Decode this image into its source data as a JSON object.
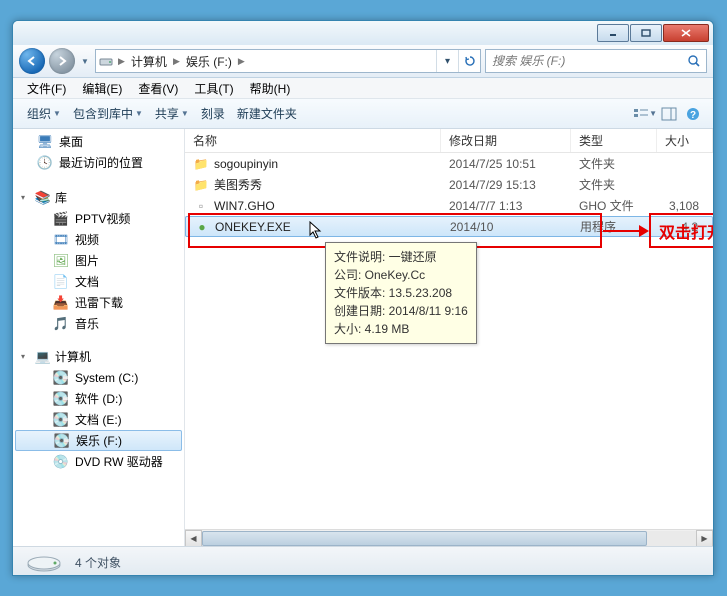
{
  "address": {
    "segments": [
      "计算机",
      "娱乐 (F:)"
    ],
    "search_placeholder": "搜索 娱乐 (F:)"
  },
  "menu": [
    "文件(F)",
    "编辑(E)",
    "查看(V)",
    "工具(T)",
    "帮助(H)"
  ],
  "toolbar": {
    "organize": "组织",
    "include": "包含到库中",
    "share": "共享",
    "burn": "刻录",
    "newfolder": "新建文件夹"
  },
  "sidebar": {
    "desktop": "桌面",
    "recent": "最近访问的位置",
    "libraries": "库",
    "lib_items": [
      "PPTV视频",
      "视频",
      "图片",
      "文档",
      "迅雷下载",
      "音乐"
    ],
    "computer": "计算机",
    "drives": [
      "System (C:)",
      "软件 (D:)",
      "文档 (E:)",
      "娱乐 (F:)",
      "DVD RW 驱动器"
    ]
  },
  "columns": {
    "name": "名称",
    "date": "修改日期",
    "type": "类型",
    "size": "大小"
  },
  "files": [
    {
      "name": "sogoupinyin",
      "date": "2014/7/25 10:51",
      "type": "文件夹",
      "size": "",
      "icon": "folder"
    },
    {
      "name": "美图秀秀",
      "date": "2014/7/29 15:13",
      "type": "文件夹",
      "size": "",
      "icon": "folder"
    },
    {
      "name": "WIN7.GHO",
      "date": "2014/7/7 1:13",
      "type": "GHO 文件",
      "size": "3,108",
      "icon": "gho"
    },
    {
      "name": "ONEKEY.EXE",
      "date": "2014/10",
      "type": "用程序",
      "size": "4,2",
      "icon": "exe",
      "selected": true
    }
  ],
  "tooltip": {
    "l1": "文件说明: 一键还原",
    "l2": "公司: OneKey.Cc",
    "l3": "文件版本: 13.5.23.208",
    "l4": "创建日期: 2014/8/11 9:16",
    "l5": "大小: 4.19 MB"
  },
  "callout_text": "双击打开",
  "status": {
    "count": "4 个对象"
  }
}
